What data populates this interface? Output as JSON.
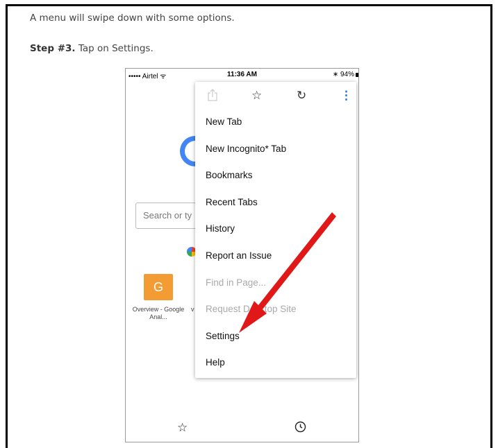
{
  "article": {
    "intro_text": "A menu will swipe down with some options.",
    "step_label": "Step #3.",
    "step_text": " Tap on Settings."
  },
  "phone": {
    "statusbar": {
      "carrier": "••••• Airtel",
      "wifi": "ᯤ",
      "time": "11:36 AM",
      "bluetooth": "∗",
      "battery": "94%"
    },
    "search_placeholder": "Search or ty",
    "shortcut": {
      "letter": "G",
      "label": "Overview - Google Anal..."
    },
    "partial_label": "v"
  },
  "menu": {
    "icons": [
      "share-icon",
      "star-icon",
      "reload-icon",
      "more-vert-icon"
    ],
    "items": [
      {
        "label": "New Tab",
        "enabled": true
      },
      {
        "label": "New Incognito* Tab",
        "enabled": true
      },
      {
        "label": "Bookmarks",
        "enabled": true
      },
      {
        "label": "Recent Tabs",
        "enabled": true
      },
      {
        "label": "History",
        "enabled": true
      },
      {
        "label": "Report an Issue",
        "enabled": true
      },
      {
        "label": "Find in Page...",
        "enabled": false
      },
      {
        "label": "Request Desktop Site",
        "enabled": false
      },
      {
        "label": "Settings",
        "enabled": true
      },
      {
        "label": "Help",
        "enabled": true
      }
    ]
  },
  "colors": {
    "arrow": "#e01818",
    "menu_more_icon": "#1a73e8",
    "tile": "#f39c34"
  }
}
